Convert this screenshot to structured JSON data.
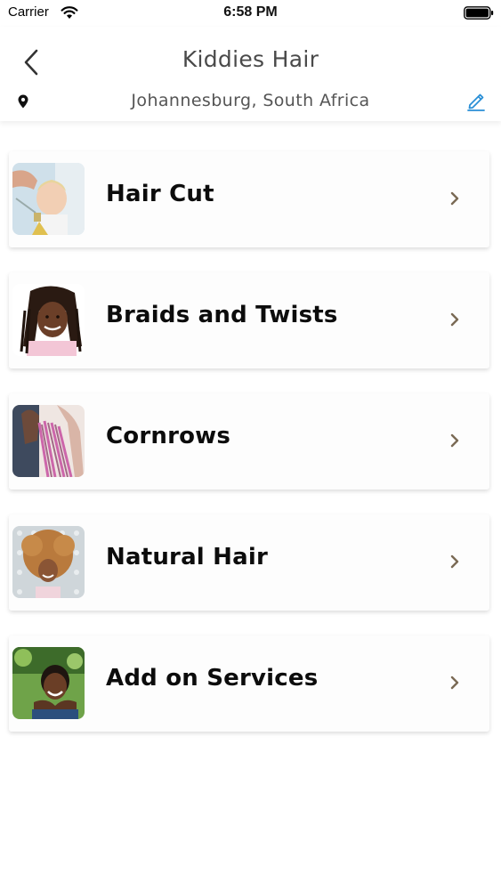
{
  "status_bar": {
    "carrier": "Carrier",
    "time": "6:58 PM"
  },
  "header": {
    "title": "Kiddies Hair",
    "location": "Johannesburg, South Africa"
  },
  "colors": {
    "edit_accent": "#2a8fd6",
    "chevron": "#7a6a55"
  },
  "services": [
    {
      "label": "Hair Cut",
      "icon": "haircut-photo"
    },
    {
      "label": "Braids and Twists",
      "icon": "braids-photo"
    },
    {
      "label": "Cornrows",
      "icon": "cornrows-photo"
    },
    {
      "label": "Natural Hair",
      "icon": "natural-hair-photo"
    },
    {
      "label": "Add on Services",
      "icon": "add-on-photo"
    }
  ]
}
